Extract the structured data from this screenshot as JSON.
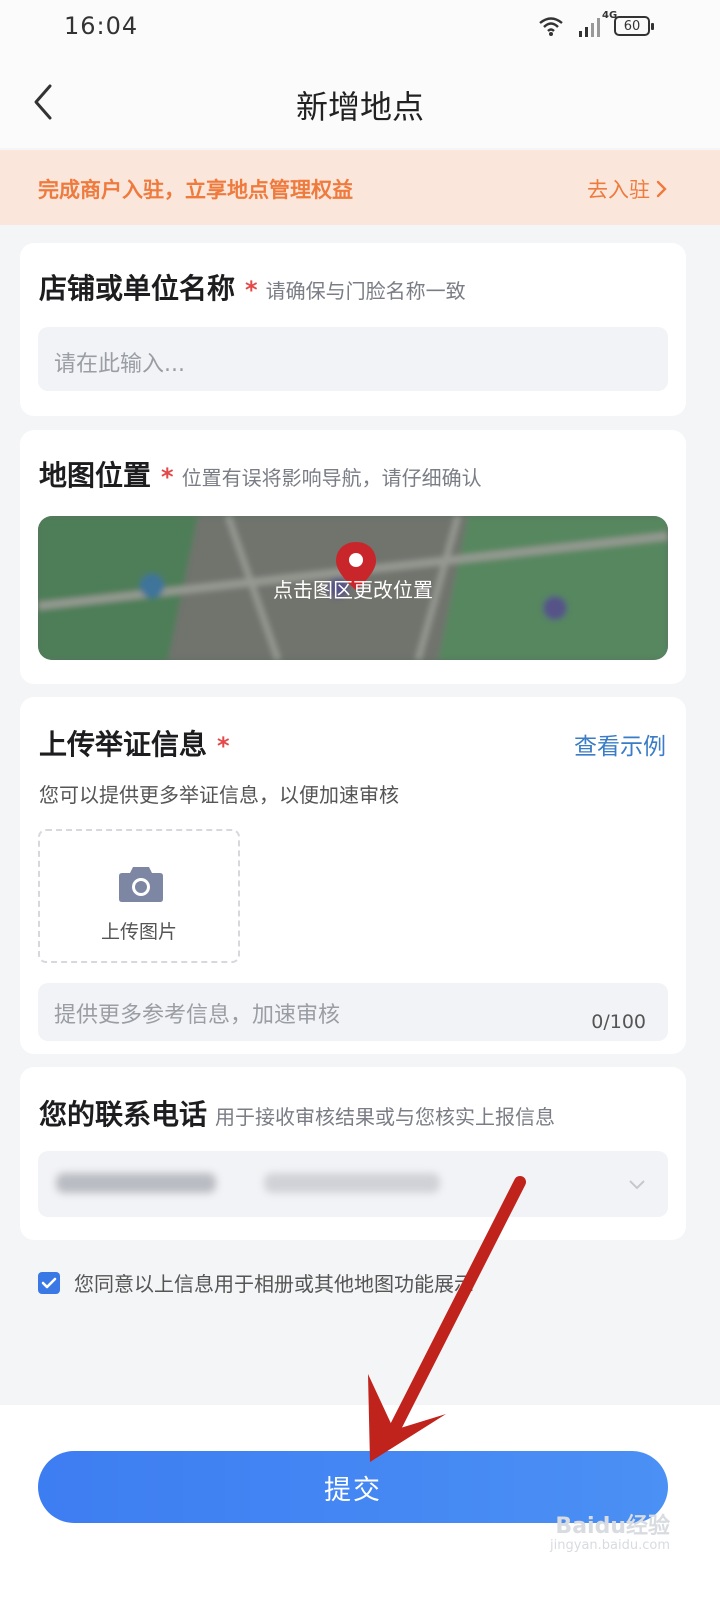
{
  "status_bar": {
    "time": "16:04",
    "network": "4G",
    "battery": "60"
  },
  "header": {
    "title": "新增地点"
  },
  "banner": {
    "text": "完成商户入驻，立享地点管理权益",
    "link": "去入驻"
  },
  "store_name": {
    "title": "店铺或单位名称",
    "required": "*",
    "hint": "请确保与门脸名称一致",
    "placeholder": "请在此输入..."
  },
  "map_location": {
    "title": "地图位置",
    "required": "*",
    "hint": "位置有误将影响导航，请仔细确认",
    "caption": "点击图区更改位置"
  },
  "evidence": {
    "title": "上传举证信息",
    "required": "*",
    "example_link": "查看示例",
    "description": "您可以提供更多举证信息，以便加速审核",
    "upload_label": "上传图片",
    "notes_placeholder": "提供更多参考信息，加速审核",
    "counter": "0/100"
  },
  "contact": {
    "title": "您的联系电话",
    "hint": "用于接收审核结果或与您核实上报信息"
  },
  "agreement": {
    "text": "您同意以上信息用于相册或其他地图功能展示",
    "checked": true
  },
  "submit": {
    "label": "提交"
  },
  "watermark": {
    "text": "Baidu经验",
    "sub": "jingyan.baidu.com"
  },
  "colors": {
    "primary": "#3d7df2",
    "banner_bg": "#fbe6dc",
    "banner_text": "#ee7b3d",
    "required": "#e54848",
    "link": "#3a7cc7",
    "annotation_arrow": "#c0221c"
  }
}
